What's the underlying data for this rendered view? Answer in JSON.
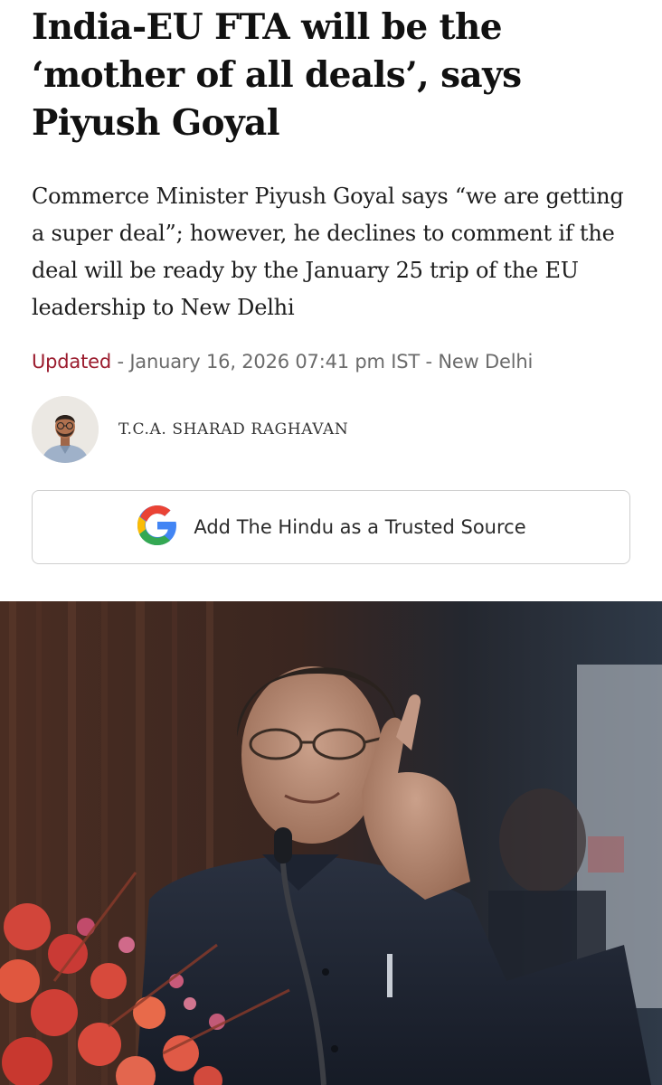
{
  "article": {
    "headline": "India-EU FTA will be the ‘mother of all deals’, says Piyush Goyal",
    "standfirst": "Commerce Minister Piyush Goyal says “we are getting a super deal”; however, he declines to comment if the deal will be ready by the January 25 trip of the EU leadership to New Delhi",
    "updated_label": "Updated",
    "meta_rest": " - January 16, 2026 07:41 pm IST - New Delhi",
    "author": "T.C.A. SHARAD RAGHAVAN"
  },
  "trusted_source": {
    "label": "Add The Hindu as a Trusted Source",
    "icon": "google-g-icon"
  },
  "colors": {
    "updated": "#9b1c2e",
    "meta": "#6b6b6b",
    "border": "#cfcfcf"
  }
}
